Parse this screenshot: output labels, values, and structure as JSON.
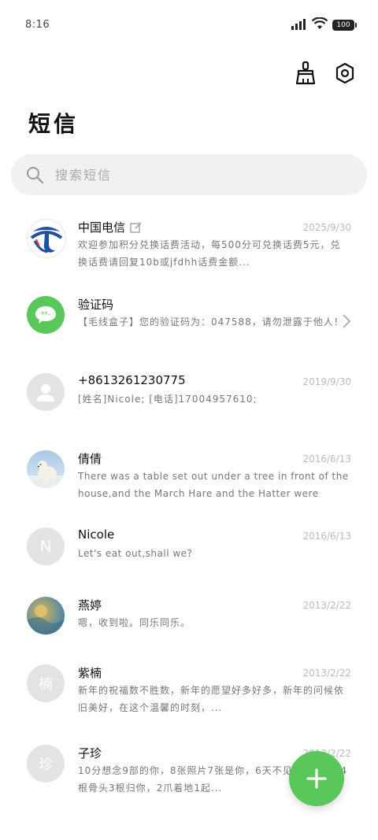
{
  "status_bar": {
    "time": "8:16",
    "battery": "100"
  },
  "header": {
    "title": "短信"
  },
  "search": {
    "placeholder": "搜索短信"
  },
  "threads": [
    {
      "name": "中国电信",
      "date": "2025/9/30",
      "preview": "欢迎参加积分兑换话费活动，每500分可兑换话费5元，兑换话费请回复10b或jfdhh话费金额..."
    },
    {
      "name": "验证码",
      "date": "",
      "preview": "【毛线盒子】您的验证码为：047588，请勿泄露于他人！"
    },
    {
      "name": "+8613261230775",
      "date": "2019/9/30",
      "preview": "[姓名]Nicole; [电话]17004957610;"
    },
    {
      "name": "倩倩",
      "date": "2016/6/13",
      "preview": "There was a table set out under a tree in front of the house,and the March Hare and the Hatter were having..."
    },
    {
      "name": "Nicole",
      "date": "2016/6/13",
      "preview": "Let's eat out,shall we?",
      "initial": "N"
    },
    {
      "name": "燕婷",
      "date": "2013/2/22",
      "preview": "嗯，收到啦。同乐同乐。"
    },
    {
      "name": "紫楠",
      "date": "2013/2/22",
      "preview": "新年的祝福数不胜数，新年的愿望好多好多，新年的问候依旧美好，在这个温馨的时刻，...",
      "initial": "楠"
    },
    {
      "name": "子珍",
      "date": "2013/2/22",
      "preview": "10分想念9部的你，8张照片7张是你，6天不见5只像你，4根骨头3根归你，2爪着地1起...",
      "initial": "珍"
    }
  ],
  "fab": {
    "icon": "plus-icon"
  },
  "colors": {
    "accent": "#5ac75a",
    "avatar_gray": "#e3e3e3",
    "telecom_blue": "#1d4fa3"
  }
}
